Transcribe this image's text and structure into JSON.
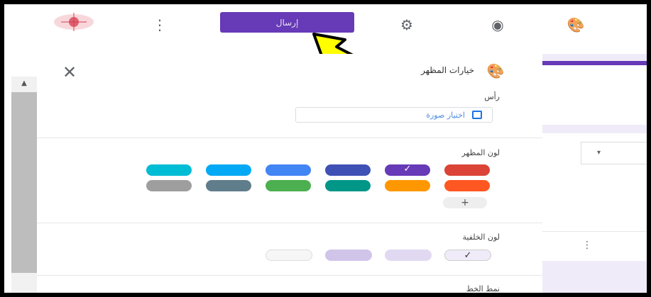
{
  "topbar": {
    "send_label": "إرسال",
    "more_icon": "⋮",
    "settings_icon": "⚙",
    "preview_icon": "◉",
    "palette_icon": "🎨"
  },
  "panel": {
    "title": "خيارات المظهر",
    "close_icon": "✕",
    "header_section": {
      "label": "رأس",
      "choose_image_label": "اختيار صورة"
    },
    "theme_color": {
      "label": "لون المظهر",
      "colors_row1": [
        "#db4437",
        "#673ab7",
        "#3f51b5",
        "#4285f4",
        "#03a9f4",
        "#00bcd4"
      ],
      "colors_row2": [
        "#ff5722",
        "#ff9800",
        "#009688",
        "#4caf50",
        "#607d8b",
        "#9e9e9e"
      ],
      "selected": "#673ab7",
      "add_label": "+"
    },
    "background_color": {
      "label": "لون الخلفية",
      "colors": [
        "#f0ebf8",
        "#e1d8f1",
        "#d1c4e9",
        "#f6f6f6"
      ],
      "selected_check": "✓"
    },
    "font_style_label": "نمط الخط"
  },
  "form_area": {
    "select_arrow": "▾",
    "more_icon": "⋮"
  },
  "accent_color": "#673ab7",
  "arrow_color": "#ffff00"
}
